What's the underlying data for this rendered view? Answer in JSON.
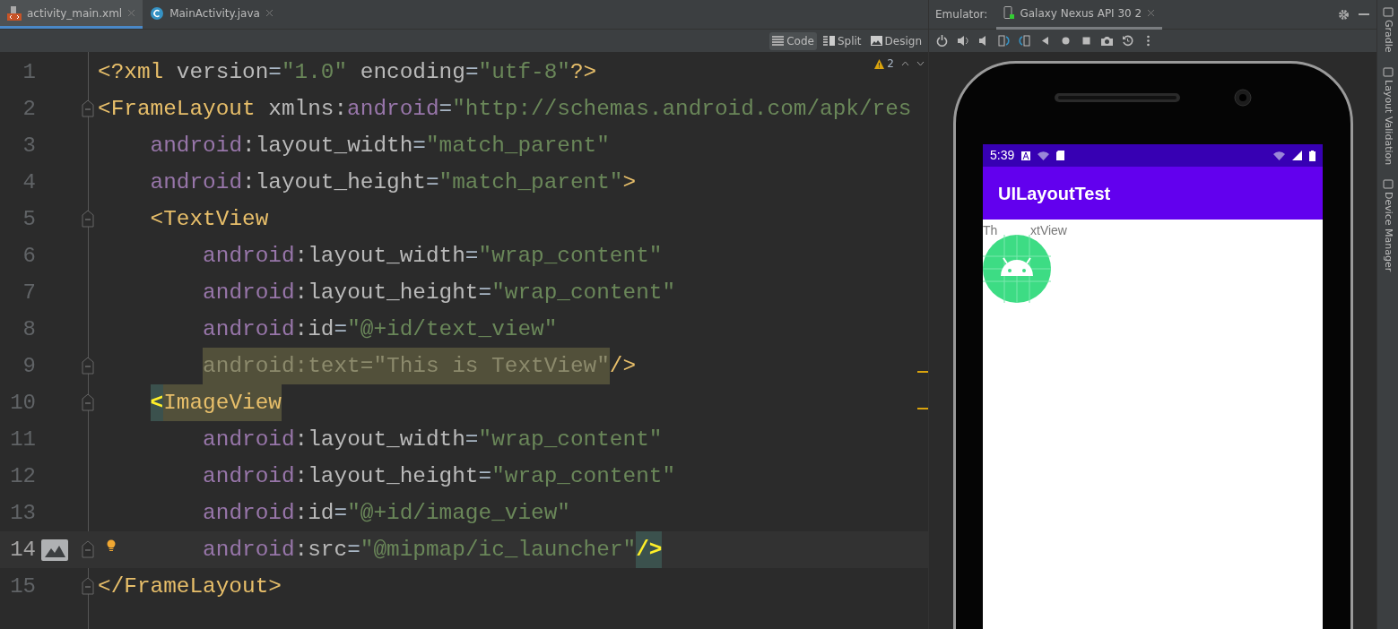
{
  "editor_tabs": [
    {
      "label": "activity_main.xml",
      "kind": "xml",
      "selected": true
    },
    {
      "label": "MainActivity.java",
      "kind": "java",
      "selected": false
    }
  ],
  "view_modes": [
    {
      "label": "Code",
      "kind": "code",
      "selected": true
    },
    {
      "label": "Split",
      "kind": "split",
      "selected": false
    },
    {
      "label": "Design",
      "kind": "design",
      "selected": false
    }
  ],
  "warnings": {
    "count": "2"
  },
  "lines": [
    {
      "number": "1",
      "tokens": [
        {
          "text": "<?xml ",
          "kind": "tag"
        },
        {
          "text": "version",
          "kind": "attr"
        },
        {
          "text": "=",
          "kind": "plain"
        },
        {
          "text": "\"1.0\" ",
          "kind": "value"
        },
        {
          "text": "encoding",
          "kind": "attr"
        },
        {
          "text": "=",
          "kind": "plain"
        },
        {
          "text": "\"utf-8\"",
          "kind": "value"
        },
        {
          "text": "?>",
          "kind": "tag"
        }
      ]
    },
    {
      "number": "2",
      "fold": true,
      "tokens": [
        {
          "text": "<FrameLayout ",
          "kind": "tag"
        },
        {
          "text": "xmlns:",
          "kind": "attr"
        },
        {
          "text": "android",
          "kind": "ns"
        },
        {
          "text": "=",
          "kind": "plain"
        },
        {
          "text": "\"http://schemas.android.com/apk/res",
          "kind": "value"
        }
      ]
    },
    {
      "number": "3",
      "tokens": [
        {
          "text": "    android",
          "kind": "ns"
        },
        {
          "text": ":layout_width",
          "kind": "attr"
        },
        {
          "text": "=",
          "kind": "plain"
        },
        {
          "text": "\"match_parent\"",
          "kind": "value"
        }
      ]
    },
    {
      "number": "4",
      "tokens": [
        {
          "text": "    android",
          "kind": "ns"
        },
        {
          "text": ":layout_height",
          "kind": "attr"
        },
        {
          "text": "=",
          "kind": "plain"
        },
        {
          "text": "\"match_parent\"",
          "kind": "value"
        },
        {
          "text": ">",
          "kind": "tag"
        }
      ]
    },
    {
      "number": "5",
      "fold": true,
      "tokens": [
        {
          "text": "    <TextView",
          "kind": "tag"
        }
      ]
    },
    {
      "number": "6",
      "tokens": [
        {
          "text": "        android",
          "kind": "ns"
        },
        {
          "text": ":layout_width",
          "kind": "attr"
        },
        {
          "text": "=",
          "kind": "plain"
        },
        {
          "text": "\"wrap_content\"",
          "kind": "value"
        }
      ]
    },
    {
      "number": "7",
      "tokens": [
        {
          "text": "        android",
          "kind": "ns"
        },
        {
          "text": ":layout_height",
          "kind": "attr"
        },
        {
          "text": "=",
          "kind": "plain"
        },
        {
          "text": "\"wrap_content\"",
          "kind": "value"
        }
      ]
    },
    {
      "number": "8",
      "tokens": [
        {
          "text": "        android",
          "kind": "ns"
        },
        {
          "text": ":id",
          "kind": "attr"
        },
        {
          "text": "=",
          "kind": "plain"
        },
        {
          "text": "\"@+id/text_view\"",
          "kind": "value"
        }
      ]
    },
    {
      "number": "9",
      "fold": true,
      "warning_marker": true,
      "tokens": [
        {
          "text": "        android:text=\"This is TextView\"",
          "kind": "warned"
        },
        {
          "text": "/>",
          "kind": "tag"
        }
      ]
    },
    {
      "number": "10",
      "fold": true,
      "warning_marker": true,
      "tokens": [
        {
          "text": "    <",
          "kind": "match"
        },
        {
          "text": "ImageView",
          "kind": "warned-tag"
        }
      ]
    },
    {
      "number": "11",
      "tokens": [
        {
          "text": "        android",
          "kind": "ns"
        },
        {
          "text": ":layout_width",
          "kind": "attr"
        },
        {
          "text": "=",
          "kind": "plain"
        },
        {
          "text": "\"wrap_content\"",
          "kind": "value"
        }
      ]
    },
    {
      "number": "12",
      "tokens": [
        {
          "text": "        android",
          "kind": "ns"
        },
        {
          "text": ":layout_height",
          "kind": "attr"
        },
        {
          "text": "=",
          "kind": "plain"
        },
        {
          "text": "\"wrap_content\"",
          "kind": "value"
        }
      ]
    },
    {
      "number": "13",
      "tokens": [
        {
          "text": "        android",
          "kind": "ns"
        },
        {
          "text": ":id",
          "kind": "attr"
        },
        {
          "text": "=",
          "kind": "plain"
        },
        {
          "text": "\"@+id/image_view\"",
          "kind": "value"
        }
      ]
    },
    {
      "number": "14",
      "current": true,
      "fold": true,
      "gutter_image": true,
      "bulb": true,
      "tokens": [
        {
          "text": "        android",
          "kind": "ns"
        },
        {
          "text": ":src",
          "kind": "attr"
        },
        {
          "text": "=",
          "kind": "plain"
        },
        {
          "text": "\"@mipmap/ic_launcher\"",
          "kind": "value"
        },
        {
          "text": "/>",
          "kind": "match"
        }
      ]
    },
    {
      "number": "15",
      "fold": true,
      "tokens": [
        {
          "text": "</FrameLayout>",
          "kind": "tag"
        }
      ]
    }
  ],
  "emulator": {
    "label": "Emulator:",
    "device_tab": "Galaxy Nexus API 30 2",
    "phone": {
      "time": "5:39",
      "app_title": "UILayoutTest",
      "text_view_parts": [
        "Th",
        "xtView"
      ]
    }
  },
  "side_tools": [
    "Gradle",
    "Layout Validation",
    "Device Manager"
  ]
}
